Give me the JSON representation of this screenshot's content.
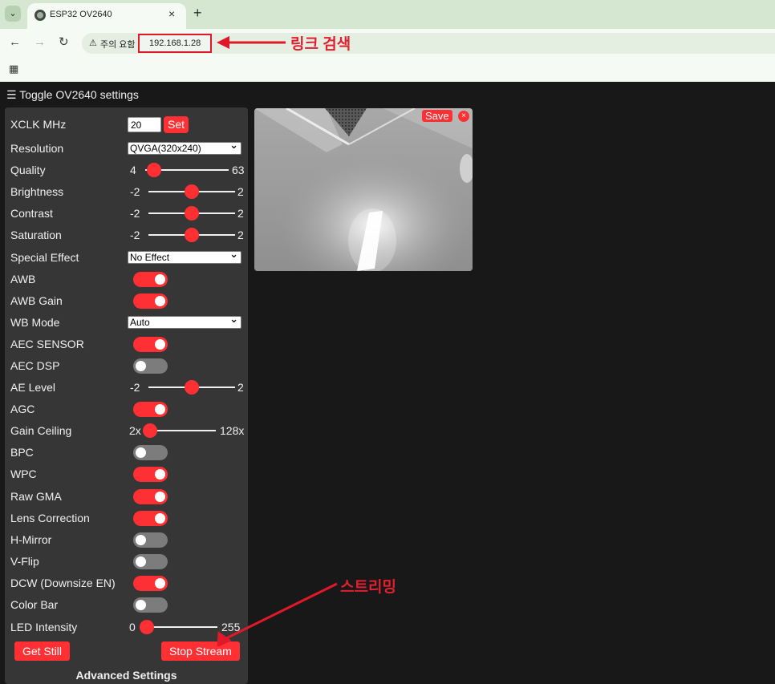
{
  "browser": {
    "tab_title": "ESP32 OV2640",
    "tab_close": "×",
    "new_tab": "+",
    "tab_search_icon": "⌄",
    "warning_text": "주의 요함",
    "url": "192.168.1.28"
  },
  "annotations": {
    "link_label": "링크 검색",
    "stream_label": "스트리밍",
    "color": "#e0192a"
  },
  "page": {
    "header": "Toggle OV2640 settings",
    "menu_icon": "☰"
  },
  "settings": {
    "xclk": {
      "label": "XCLK MHz",
      "value": "20",
      "button": "Set"
    },
    "resolution": {
      "label": "Resolution",
      "value": "QVGA(320x240)"
    },
    "quality": {
      "label": "Quality",
      "min": "4",
      "max": "63",
      "value": 10
    },
    "brightness": {
      "label": "Brightness",
      "min": "-2",
      "max": "2",
      "value": 0
    },
    "contrast": {
      "label": "Contrast",
      "min": "-2",
      "max": "2",
      "value": 0
    },
    "saturation": {
      "label": "Saturation",
      "min": "-2",
      "max": "2",
      "value": 0
    },
    "special_effect": {
      "label": "Special Effect",
      "value": "No Effect"
    },
    "awb": {
      "label": "AWB",
      "on": true
    },
    "awb_gain": {
      "label": "AWB Gain",
      "on": true
    },
    "wb_mode": {
      "label": "WB Mode",
      "value": "Auto"
    },
    "aec_sensor": {
      "label": "AEC SENSOR",
      "on": true
    },
    "aec_dsp": {
      "label": "AEC DSP",
      "on": false
    },
    "ae_level": {
      "label": "AE Level",
      "min": "-2",
      "max": "2",
      "value": 0
    },
    "agc": {
      "label": "AGC",
      "on": true
    },
    "gain_ceiling": {
      "label": "Gain Ceiling",
      "min": "2x",
      "max": "128x",
      "value": 0
    },
    "bpc": {
      "label": "BPC",
      "on": false
    },
    "wpc": {
      "label": "WPC",
      "on": true
    },
    "raw_gma": {
      "label": "Raw GMA",
      "on": true
    },
    "lens_correction": {
      "label": "Lens Correction",
      "on": true
    },
    "h_mirror": {
      "label": "H-Mirror",
      "on": false
    },
    "v_flip": {
      "label": "V-Flip",
      "on": false
    },
    "dcw": {
      "label": "DCW (Downsize EN)",
      "on": true
    },
    "color_bar": {
      "label": "Color Bar",
      "on": false
    },
    "led_intensity": {
      "label": "LED Intensity",
      "min": "0",
      "max": "255",
      "value": 0
    }
  },
  "buttons": {
    "get_still": "Get Still",
    "stop_stream": "Stop Stream"
  },
  "advanced_title": "Advanced Settings",
  "stream": {
    "save": "Save",
    "close": "×"
  },
  "colors": {
    "accent": "#ff3034",
    "panel": "#363636",
    "background": "#181818"
  }
}
